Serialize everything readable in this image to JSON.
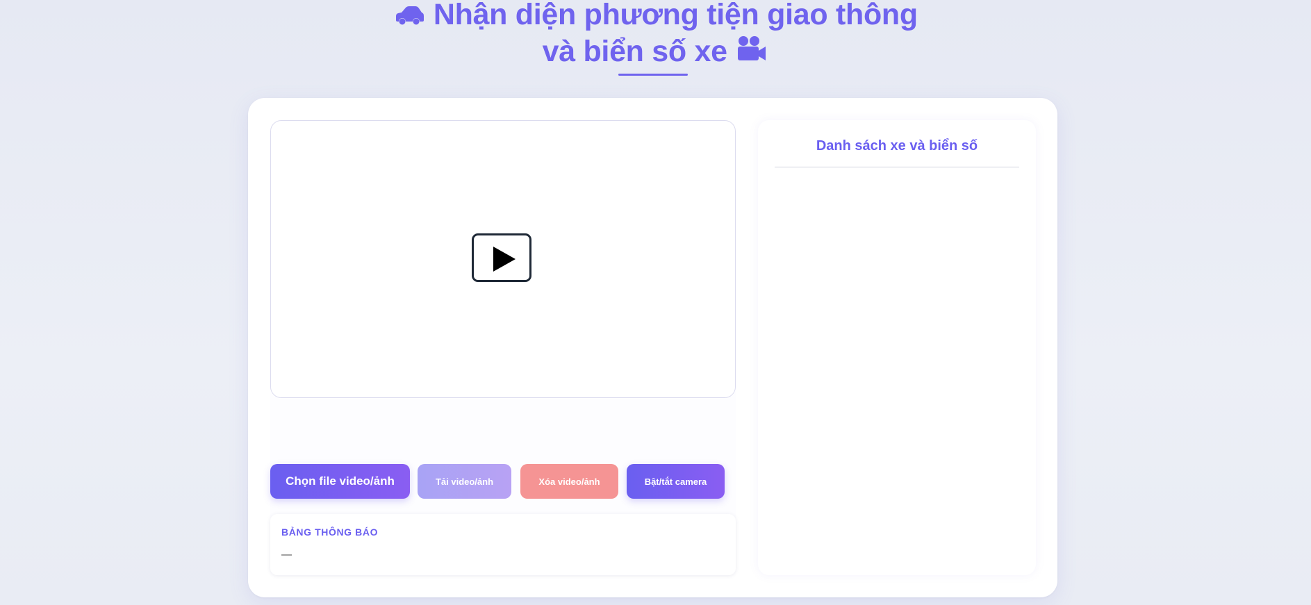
{
  "header": {
    "title_line1": "Nhận diện phương tiện giao thông",
    "title_line2": "và biển số xe",
    "icon_left": "car-icon",
    "icon_right": "video-camera-icon"
  },
  "video": {
    "play_icon": "play-icon"
  },
  "controls": {
    "choose_file": "Chọn file video/ảnh",
    "upload": "Tải video/ảnh",
    "delete": "Xóa video/ảnh",
    "toggle_camera": "Bật/tắt camera"
  },
  "notice": {
    "title": "BẢNG THÔNG BÁO",
    "text": "—"
  },
  "vehicle_panel": {
    "title": "Danh sách xe và biển số",
    "items": []
  },
  "colors": {
    "accent": "#6a5ff0",
    "accent_light": "#a8a3f5",
    "danger_light": "#f59494",
    "background": "#e6e9f3"
  }
}
